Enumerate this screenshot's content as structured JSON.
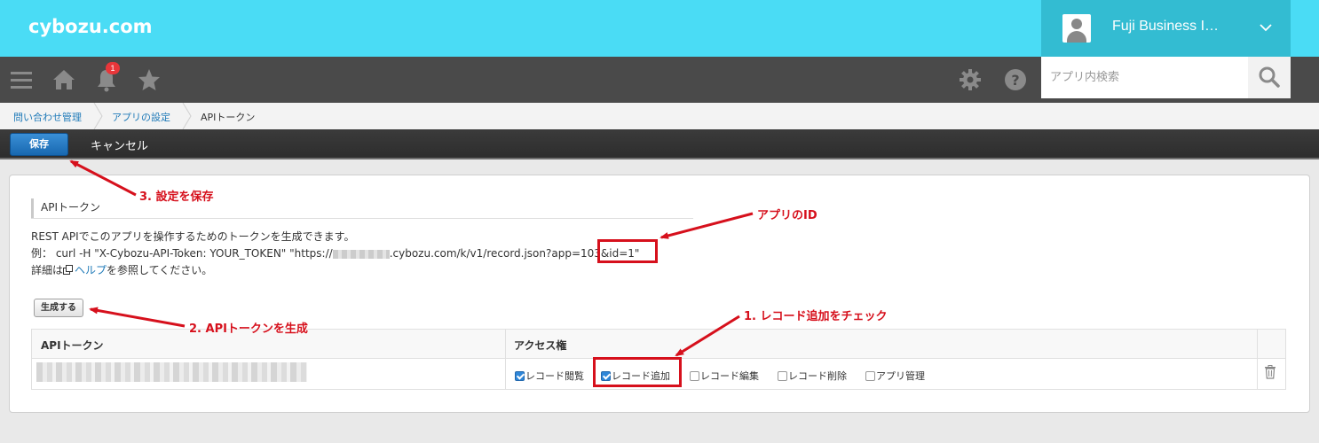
{
  "header": {
    "logo": "cybozu.com",
    "user_name": "Fuji Business I…"
  },
  "toolbar": {
    "notification_count": "1",
    "search_placeholder": "アプリ内検索"
  },
  "breadcrumb": [
    "問い合わせ管理",
    "アプリの設定",
    "APIトークン"
  ],
  "actions": {
    "save_label": "保存",
    "cancel_label": "キャンセル"
  },
  "section": {
    "title": "APIトークン",
    "desc_line1": "REST APIでこのアプリを操作するためのトークンを生成できます。",
    "example_prefix": "例： curl -H \"X-Cybozu-API-Token: YOUR_TOKEN\" \"https://",
    "example_suffix": ".cybozu.com/k/v1/record.json?app=103&id=1\"",
    "help_prefix": "詳細は",
    "help_link": "ヘルプ",
    "help_suffix": "を参照してください。",
    "generate_label": "生成する"
  },
  "table": {
    "col_token": "APIトークン",
    "col_access": "アクセス権",
    "permissions": [
      {
        "label": "レコード閲覧",
        "checked": true
      },
      {
        "label": "レコード追加",
        "checked": true
      },
      {
        "label": "レコード編集",
        "checked": false
      },
      {
        "label": "レコード削除",
        "checked": false
      },
      {
        "label": "アプリ管理",
        "checked": false
      }
    ]
  },
  "annotations": {
    "save_note": "3. 設定を保存",
    "appid_note": "アプリのID",
    "generate_note": "2. APIトークンを生成",
    "check_note": "1. レコード追加をチェック",
    "color": "#d6101c"
  },
  "colors": {
    "header": "#4adcf5",
    "user_box": "#33bcd2",
    "toolbar": "#4a4a4a",
    "save_button": "#1f78c8",
    "link": "#1f7ab8"
  }
}
